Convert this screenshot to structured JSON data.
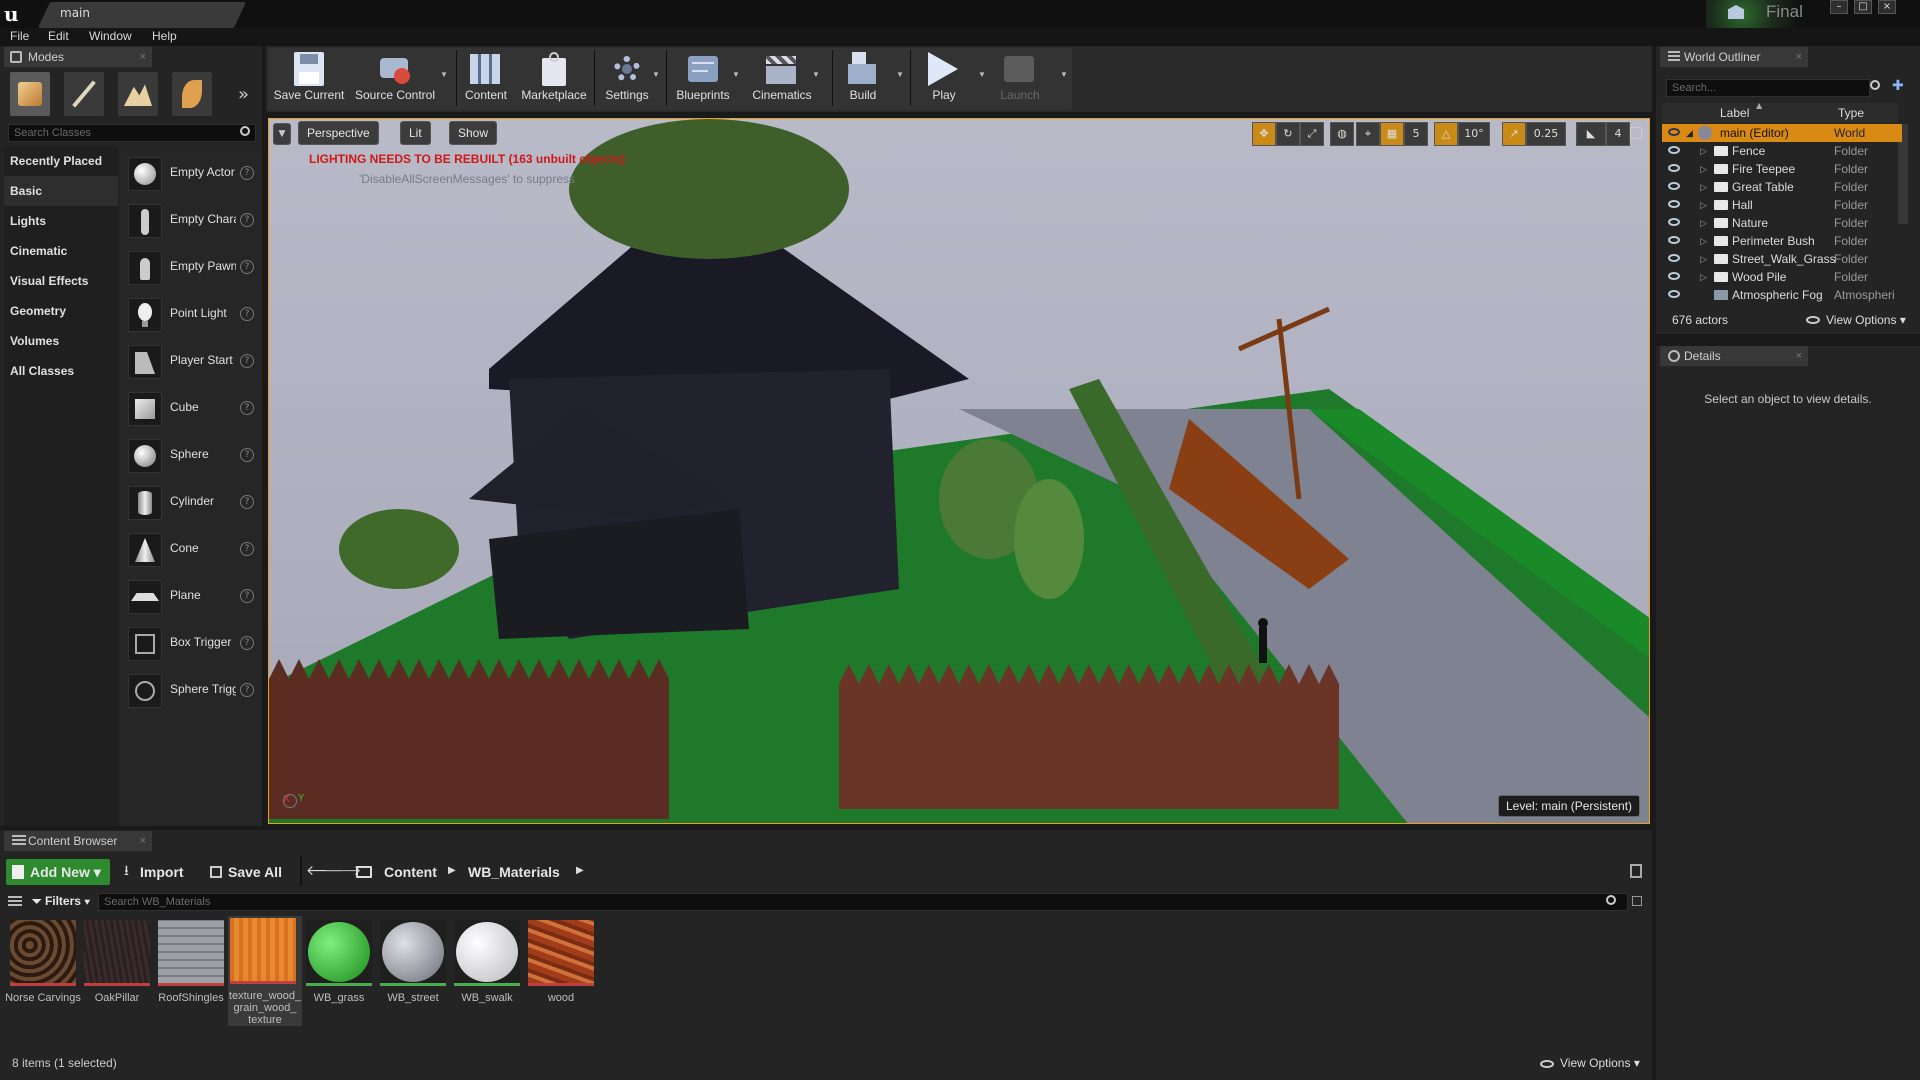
{
  "window": {
    "tab_title": "main",
    "badge": "Final"
  },
  "menu": [
    "File",
    "Edit",
    "Window",
    "Help"
  ],
  "modes": {
    "tab": "Modes",
    "search_placeholder": "Search Classes",
    "categories": [
      "Recently Placed",
      "Basic",
      "Lights",
      "Cinematic",
      "Visual Effects",
      "Geometry",
      "Volumes",
      "All Classes"
    ],
    "selected_category": "Basic",
    "items": [
      "Empty Actor",
      "Empty Character",
      "Empty Pawn",
      "Point Light",
      "Player Start",
      "Cube",
      "Sphere",
      "Cylinder",
      "Cone",
      "Plane",
      "Box Trigger",
      "Sphere Trigger"
    ]
  },
  "toolbar": {
    "save_current": "Save Current",
    "source_control": "Source Control",
    "content": "Content",
    "marketplace": "Marketplace",
    "settings": "Settings",
    "blueprints": "Blueprints",
    "cinematics": "Cinematics",
    "build": "Build",
    "play": "Play",
    "launch": "Launch"
  },
  "viewport": {
    "perspective": "Perspective",
    "lit": "Lit",
    "show": "Show",
    "warning": "LIGHTING NEEDS TO BE REBUILT (163 unbuilt objects)",
    "suppress_hint": "'DisableAllScreenMessages' to suppress",
    "grid_snap": "5",
    "rotation_snap": "10°",
    "scale_snap": "0.25",
    "camera_speed": "4",
    "level": "Level:  main (Persistent)",
    "axis_x": "X",
    "axis_y": "Y",
    "accent": "#e8a020"
  },
  "outliner": {
    "tab": "World Outliner",
    "search_placeholder": "Search...",
    "col_label": "Label",
    "col_type": "Type",
    "rows": [
      {
        "label": "main (Editor)",
        "type": "World"
      },
      {
        "label": "Fence",
        "type": "Folder"
      },
      {
        "label": "Fire Teepee",
        "type": "Folder"
      },
      {
        "label": "Great Table",
        "type": "Folder"
      },
      {
        "label": "Hall",
        "type": "Folder"
      },
      {
        "label": "Nature",
        "type": "Folder"
      },
      {
        "label": "Perimeter Bush",
        "type": "Folder"
      },
      {
        "label": "Street_Walk_Grass",
        "type": "Folder"
      },
      {
        "label": "Wood Pile",
        "type": "Folder"
      },
      {
        "label": "Atmospheric Fog",
        "type": "Atmospheri"
      }
    ],
    "actor_count": "676 actors",
    "view_options": "View Options"
  },
  "details": {
    "tab": "Details",
    "empty_message": "Select an object to view details."
  },
  "content_browser": {
    "tab": "Content Browser",
    "add_new": "Add New",
    "import": "Import",
    "save_all": "Save All",
    "path": [
      "Content",
      "WB_Materials"
    ],
    "filters": "Filters",
    "search_placeholder": "Search WB_Materials",
    "assets": [
      {
        "name": "Norse Carvings"
      },
      {
        "name": "OakPillar"
      },
      {
        "name": "RoofShingles"
      },
      {
        "name": "texture_wood_ grain_wood_ texture"
      },
      {
        "name": "WB_grass"
      },
      {
        "name": "WB_street"
      },
      {
        "name": "WB_swalk"
      },
      {
        "name": "wood"
      }
    ],
    "status": "8 items (1 selected)",
    "view_options": "View Options"
  }
}
